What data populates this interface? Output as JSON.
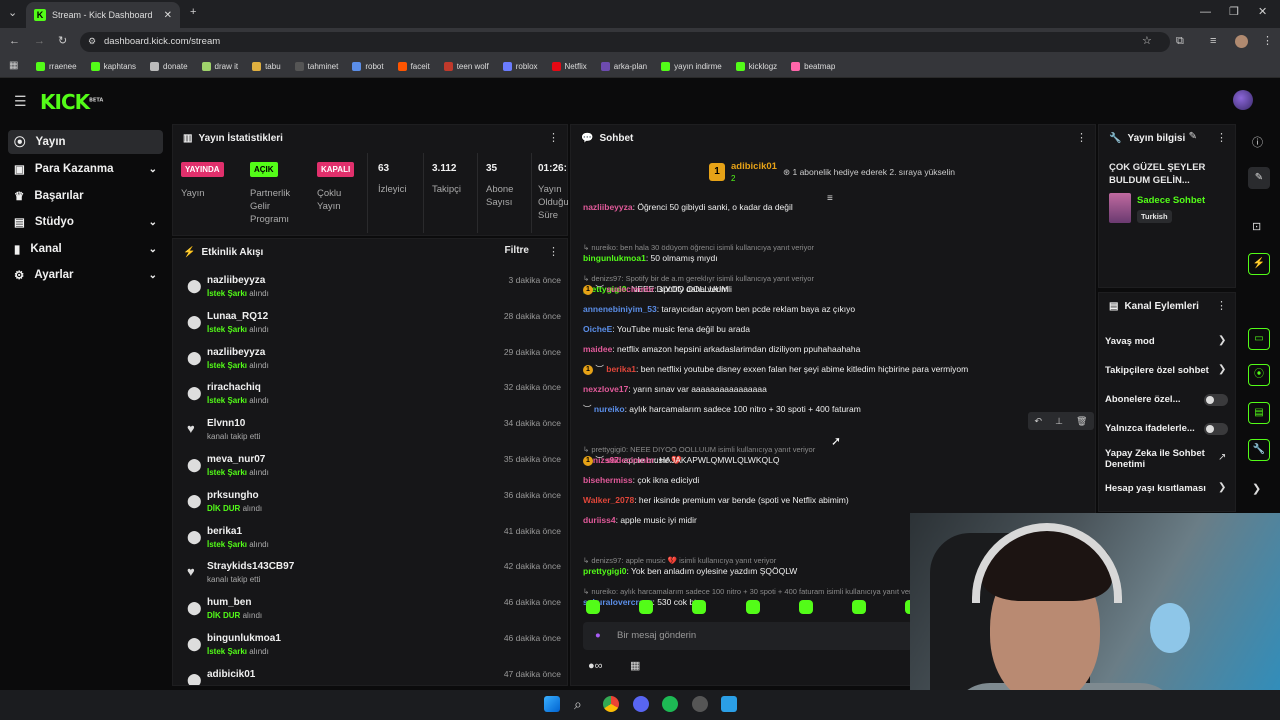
{
  "browser": {
    "tab_title": "Stream - Kick Dashboard",
    "url": "dashboard.kick.com/stream",
    "bookmarks": [
      {
        "label": "rraenee",
        "color": "#53fc18"
      },
      {
        "label": "kaphtans",
        "color": "#53fc18"
      },
      {
        "label": "donate",
        "color": "#bbbbbb"
      },
      {
        "label": "draw it",
        "color": "#9fd36b"
      },
      {
        "label": "tabu",
        "color": "#e0b040"
      },
      {
        "label": "tahminet",
        "color": "#555555"
      },
      {
        "label": "robot",
        "color": "#5b8ee8"
      },
      {
        "label": "faceit",
        "color": "#ff5500"
      },
      {
        "label": "teen wolf",
        "color": "#c0392b"
      },
      {
        "label": "roblox",
        "color": "#6a7cff"
      },
      {
        "label": "Netflix",
        "color": "#e50914"
      },
      {
        "label": "arka-plan",
        "color": "#6d4bb0"
      },
      {
        "label": "yayın indirme",
        "color": "#53fc18"
      },
      {
        "label": "kicklogz",
        "color": "#53fc18"
      },
      {
        "label": "beatmap",
        "color": "#ff66aa"
      }
    ]
  },
  "app": {
    "logo": "KICK",
    "logo_sup": "BETA"
  },
  "sidebar": {
    "items": [
      {
        "label": "Yayın",
        "icon": "broadcast-icon",
        "active": true,
        "chevron": false
      },
      {
        "label": "Para Kazanma",
        "icon": "money-icon",
        "active": false,
        "chevron": true
      },
      {
        "label": "Başarılar",
        "icon": "trophy-icon",
        "active": false,
        "chevron": false
      },
      {
        "label": "Stüdyo",
        "icon": "studio-icon",
        "active": false,
        "chevron": true
      },
      {
        "label": "Kanal",
        "icon": "channel-icon",
        "active": false,
        "chevron": true
      },
      {
        "label": "Ayarlar",
        "icon": "gear-icon",
        "active": false,
        "chevron": true
      }
    ]
  },
  "stats": {
    "title": "Yayın İstatistikleri",
    "live_badge": "YAYINDA",
    "live_label": "Yayın",
    "partner_badge": "AÇIK",
    "partner_label": [
      "Partnerlik",
      "Gelir",
      "Programı"
    ],
    "multi_badge": "KAPALI",
    "multi_label": [
      "Çoklu",
      "Yayın"
    ],
    "viewers": "63",
    "viewers_label": "İzleyici",
    "followers": "3.112",
    "followers_label": "Takipçi",
    "subs": "35",
    "subs_label": [
      "Abone",
      "Sayısı"
    ],
    "duration": "01:26:",
    "duration_label": [
      "Yayın",
      "Olduğu",
      "Süre"
    ]
  },
  "activity": {
    "title": "Etkinlik Akışı",
    "filter": "Filtre",
    "items": [
      {
        "name": "nazliibeyyza",
        "kind": "İstek Şarkı",
        "suffix": "alındı",
        "time": "3 dakika önce",
        "heart": false
      },
      {
        "name": "Lunaa_RQ12",
        "kind": "İstek Şarkı",
        "suffix": "alındı",
        "time": "28 dakika önce",
        "heart": false
      },
      {
        "name": "nazliibeyyza",
        "kind": "İstek Şarkı",
        "suffix": "alındı",
        "time": "29 dakika önce",
        "heart": false
      },
      {
        "name": "rirachachiq",
        "kind": "İstek Şarkı",
        "suffix": "alındı",
        "time": "32 dakika önce",
        "heart": false
      },
      {
        "name": "Elvnn10",
        "kind": "",
        "suffix": "kanalı takip etti",
        "time": "34 dakika önce",
        "heart": true
      },
      {
        "name": "meva_nur07",
        "kind": "İstek Şarkı",
        "suffix": "alındı",
        "time": "35 dakika önce",
        "heart": false
      },
      {
        "name": "prksungho",
        "kind": "DİK DUR",
        "suffix": "alındı",
        "time": "36 dakika önce",
        "heart": false
      },
      {
        "name": "berika1",
        "kind": "İstek Şarkı",
        "suffix": "alındı",
        "time": "41 dakika önce",
        "heart": false
      },
      {
        "name": "Straykids143CB97",
        "kind": "",
        "suffix": "kanalı takip etti",
        "time": "42 dakika önce",
        "heart": true
      },
      {
        "name": "hum_ben",
        "kind": "DİK DUR",
        "suffix": "alındı",
        "time": "46 dakika önce",
        "heart": false
      },
      {
        "name": "bingunlukmoa1",
        "kind": "İstek Şarkı",
        "suffix": "alındı",
        "time": "46 dakika önce",
        "heart": false
      },
      {
        "name": "adibicik01",
        "kind": "",
        "suffix": "",
        "time": "47 dakika önce",
        "heart": false
      }
    ]
  },
  "chat": {
    "title": "Sohbet",
    "pinned_user": "adibicik01",
    "pinned_count": "2",
    "pinned_text": "1 abonelik hediye ederek 2. sıraya yükselin",
    "input_placeholder": "Bir mesaj gönderin",
    "messages": [
      {
        "reply": "",
        "badge": "",
        "name": "nazliibeyyza",
        "color": "#e15a9a",
        "text": ": Öğrenci 50 gibiydi sanki, o kadar da değil"
      },
      {
        "reply": "nureiko: ben hala 30 ödüyom öğrenci isimli kullanıcıya yanıt veriyor",
        "badge": "",
        "name": "bingunlukmoa1",
        "color": "#53fc18",
        "text": ": 50 olmamış mıydı"
      },
      {
        "reply": "denizs97: Spotify bir de a.m gereklıyr isimli kullanıcıya yanıt veriyor",
        "badge": "",
        "name": "prettygigi0",
        "color": "#53fc18",
        "text": ": NEEE DIYOO OOLLUUM"
      },
      {
        "reply": "",
        "badge": "sub",
        "name": "sudecimnbr",
        "color": "#e15a9a",
        "text": ": spotify daha verimli"
      },
      {
        "reply": "",
        "badge": "",
        "name": "annenebiniyim_53",
        "color": "#5b8ee8",
        "text": ": tarayıcıdan açıyom ben pcde reklam baya az çıkıyo"
      },
      {
        "reply": "",
        "badge": "",
        "name": "OicheE",
        "color": "#5b8ee8",
        "text": ": YouTube music fena değil bu arada"
      },
      {
        "reply": "",
        "badge": "",
        "name": "maidee",
        "color": "#e15a9a",
        "text": ": netflix amazon hepsini arkadaslarimdan diziliyom ppuhahaahaha"
      },
      {
        "reply": "",
        "badge": "sub",
        "name": "berika1",
        "color": "#e0463a",
        "text": ": ben netflixi youtube disney exxen falan her şeyi abime kitledim hiçbirine para vermiyom"
      },
      {
        "reply": "",
        "badge": "",
        "name": "nexzlove17",
        "color": "#e15a9a",
        "text": ": yarın sınav var aaaaaaaaaaaaaaaa"
      },
      {
        "reply": "",
        "badge": "mod",
        "name": "nureiko",
        "color": "#5b8ee8",
        "text": ": aylık harcamalarım sadece 100 nitro + 30 spoti + 400 faturam"
      },
      {
        "reply": "prettygigi0: NEEE DIYOO OOLLUUM isimli kullanıcıya yanıt veriyor",
        "badge": "",
        "name": "denizs97",
        "color": "#e15a9a",
        "text": ": apple music 💔"
      },
      {
        "reply": "",
        "badge": "sub",
        "name": "sudecimnbr",
        "color": "#e15a9a",
        "text": ": HAJAKAPWLQMWLQLWKQLQ"
      },
      {
        "reply": "",
        "badge": "",
        "name": "bisehermiss",
        "color": "#e15a9a",
        "text": ": çok ikna ediciydi"
      },
      {
        "reply": "",
        "badge": "",
        "name": "Walker_2078",
        "color": "#e0463a",
        "text": ": her iksinde premium var bende (spoti ve Netflix abimim)"
      },
      {
        "reply": "",
        "badge": "",
        "name": "duriiss4",
        "color": "#e15a9a",
        "text": ": apple music iyi midir"
      },
      {
        "reply": "denizs97: apple music 💔 isimli kullanıcıya yanıt veriyor",
        "badge": "",
        "name": "prettygigi0",
        "color": "#53fc18",
        "text": ": Yok ben anladım oylesine yazdım ŞQÖQLW"
      },
      {
        "reply": "nureiko: aylık harcamalarım sadece 100 nitro + 30 spoti + 400 faturam isimli kullanıcıya yanıt veriyor",
        "badge": "",
        "name": "sakuralovercrazy",
        "color": "#5b8ee8",
        "text": ": 530 cok btw"
      }
    ]
  },
  "stream_info": {
    "title": "Yayın bilgisi",
    "stream_title": "ÇOK GÜZEL ŞEYLER BULDUM GELİN...",
    "category": "Sadece Sohbet",
    "language": "Turkish"
  },
  "channel_actions": {
    "title": "Kanal Eylemleri",
    "items": [
      {
        "label": "Yavaş mod",
        "control": "chevron"
      },
      {
        "label": "Takipçilere özel sohbet",
        "control": "chevron"
      },
      {
        "label": "Abonelere özel...",
        "control": "toggle"
      },
      {
        "label": "Yalnızca ifadelerle...",
        "control": "toggle"
      },
      {
        "label": "Yapay Zeka ile Sohbet Denetimi",
        "control": "external"
      },
      {
        "label": "Hesap yaşı kısıtlaması",
        "control": "chevron"
      }
    ]
  },
  "colors": {
    "accent": "#53fc18",
    "live": "#e1306c",
    "off": "#e1306c"
  }
}
